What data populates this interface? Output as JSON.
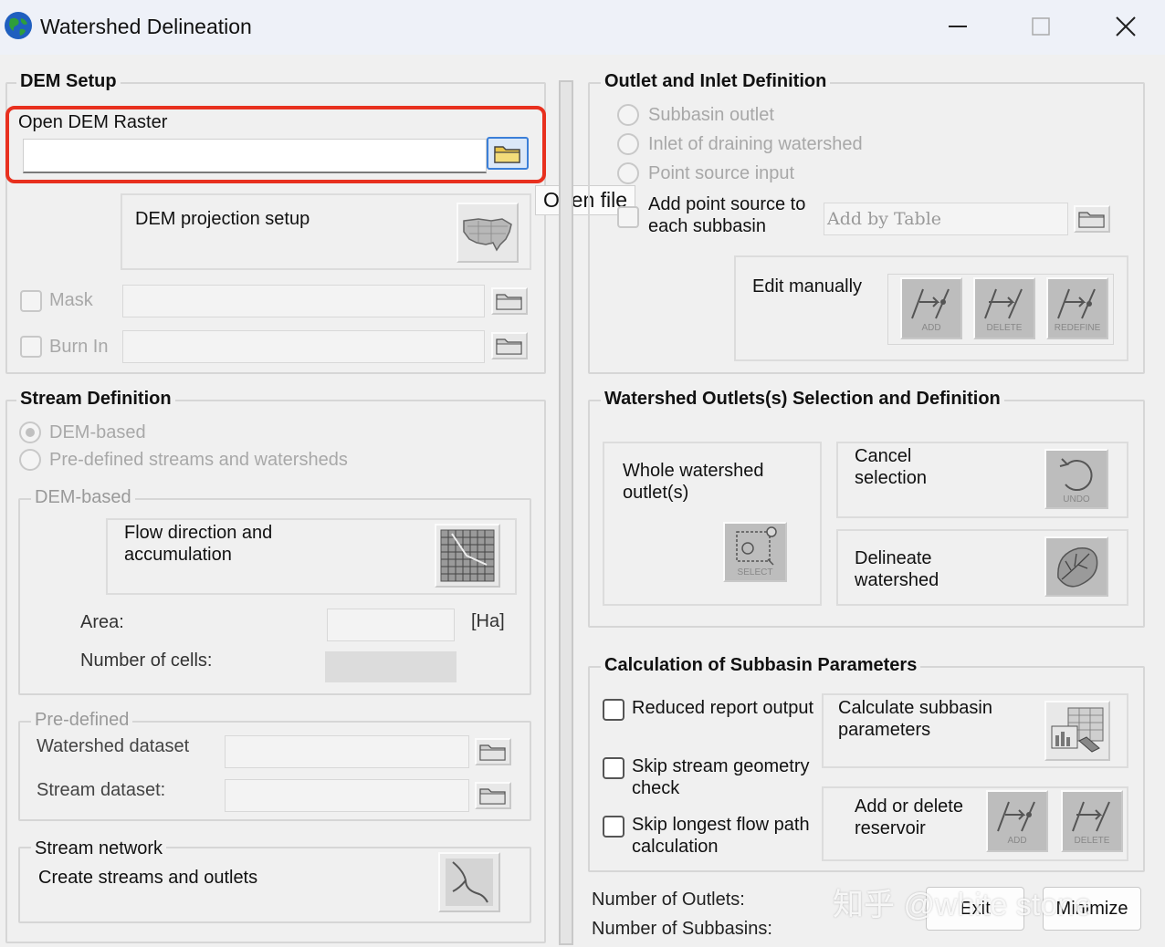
{
  "window": {
    "title": "Watershed Delineation",
    "icon": "globe-icon",
    "controls": [
      "minimize-icon",
      "maximize-icon",
      "close-icon"
    ]
  },
  "dem_setup": {
    "title": "DEM Setup",
    "open_dem_label": "Open DEM Raster",
    "open_dem_value": "",
    "projection_label": "DEM projection setup",
    "mask_label": "Mask",
    "burn_in_label": "Burn In",
    "tooltip": "Open file"
  },
  "stream_def": {
    "title": "Stream Definition",
    "dem_based_radio": "DEM-based",
    "predefined_radio": "Pre-defined streams and watersheds",
    "dem_based_group": "DEM-based",
    "flow_label": "Flow direction and accumulation",
    "area_label": "Area:",
    "area_unit": "[Ha]",
    "cells_label": "Number of cells:",
    "predefined_group": "Pre-defined",
    "watershed_dataset_label": "Watershed dataset",
    "stream_dataset_label": "Stream dataset:",
    "network_title": "Stream network",
    "create_streams_label": "Create streams and outlets"
  },
  "outlet_inlet": {
    "title": "Outlet and Inlet Definition",
    "subbasin_outlet": "Subbasin outlet",
    "inlet_draining": "Inlet of draining watershed",
    "point_source": "Point source input",
    "add_point_source": "Add point source to each subbasin",
    "add_by_table": "Add by Table",
    "edit_manually": "Edit manually",
    "btn_add": "ADD",
    "btn_delete": "DELETE",
    "btn_redefine": "REDEFINE"
  },
  "outlet_selection": {
    "title": "Watershed Outlets(s) Selection and Definition",
    "whole_outlet": "Whole watershed outlet(s)",
    "select_caption": "SELECT",
    "cancel_selection": "Cancel selection",
    "undo_caption": "UNDO",
    "delineate": "Delineate watershed"
  },
  "calc_params": {
    "title": "Calculation of Subbasin Parameters",
    "reduced_report": "Reduced  report output",
    "skip_stream": "Skip stream geometry check",
    "skip_longest": "Skip longest flow path calculation",
    "calculate_subbasin": "Calculate subbasin parameters",
    "add_delete_reservoir": "Add or delete reservoir",
    "btn_add": "ADD",
    "btn_delete": "DELETE"
  },
  "footer": {
    "num_outlets": "Number of Outlets:",
    "num_subbasins": "Number of Subbasins:",
    "exit_label": "Exit",
    "minimize_label": "Minimize"
  },
  "watermark": "知乎 @white stone",
  "colors": {
    "highlight": "#e8301e",
    "folder": "#e8c44a"
  }
}
